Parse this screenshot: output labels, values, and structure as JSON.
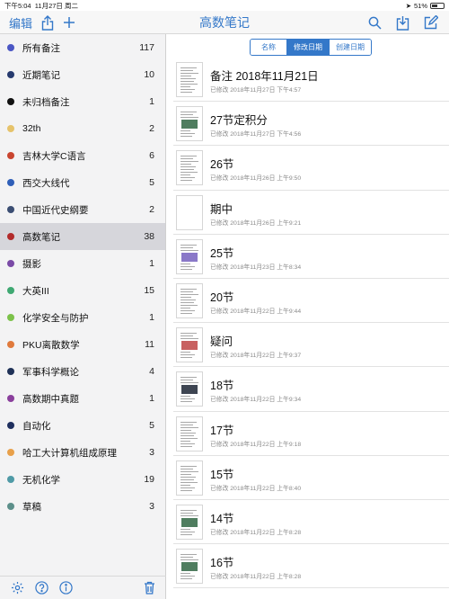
{
  "status": {
    "time": "下午5:04",
    "date": "11月27日 周二",
    "battery_text": "51%",
    "battery_level": 0.51
  },
  "nav": {
    "edit": "编辑",
    "title": "高数笔记"
  },
  "sort": {
    "name": "名称",
    "modified": "修改日期",
    "created": "创建日期",
    "active": "modified"
  },
  "folders": [
    {
      "name": "所有备注",
      "count": "117",
      "color": "#4a56c4"
    },
    {
      "name": "近期笔记",
      "count": "10",
      "color": "#263a6e"
    },
    {
      "name": "未归档备注",
      "count": "1",
      "color": "#111111"
    },
    {
      "name": "32th",
      "count": "2",
      "color": "#e6c36b"
    },
    {
      "name": "吉林大学C语言",
      "count": "6",
      "color": "#c9452f"
    },
    {
      "name": "西交大线代",
      "count": "5",
      "color": "#2f5fb8"
    },
    {
      "name": "中国近代史纲要",
      "count": "2",
      "color": "#3b4e73"
    },
    {
      "name": "高数笔记",
      "count": "38",
      "color": "#b22b2b"
    },
    {
      "name": "摄影",
      "count": "1",
      "color": "#7a4aa6"
    },
    {
      "name": "大英III",
      "count": "15",
      "color": "#3fa872"
    },
    {
      "name": "化学安全与防护",
      "count": "1",
      "color": "#7cc24a"
    },
    {
      "name": "PKU离散数学",
      "count": "11",
      "color": "#e07a3c"
    },
    {
      "name": "军事科学概论",
      "count": "4",
      "color": "#1f3157"
    },
    {
      "name": "高数期中真题",
      "count": "1",
      "color": "#8a3f9c"
    },
    {
      "name": "自动化",
      "count": "5",
      "color": "#1f2f5e"
    },
    {
      "name": "哈工大计算机组成原理",
      "count": "3",
      "color": "#e8a04a"
    },
    {
      "name": "无机化学",
      "count": "19",
      "color": "#4f9aa6"
    },
    {
      "name": "草稿",
      "count": "3",
      "color": "#5c8f8a"
    }
  ],
  "notes": [
    {
      "title": "备注 2018年11月21日",
      "meta": "已修改 2018年11月27日 下午4:57",
      "thumb": "text"
    },
    {
      "title": "27节定积分",
      "meta": "已修改 2018年11月27日 下午4:56",
      "thumb": "green"
    },
    {
      "title": "26节",
      "meta": "已修改 2018年11月26日 上午9:50",
      "thumb": "text"
    },
    {
      "title": "期中",
      "meta": "已修改 2018年11月26日 上午9:21",
      "thumb": "blank"
    },
    {
      "title": "25节",
      "meta": "已修改 2018年11月23日 上午8:34",
      "thumb": "purple"
    },
    {
      "title": "20节",
      "meta": "已修改 2018年11月22日 上午9:44",
      "thumb": "text"
    },
    {
      "title": "疑问",
      "meta": "已修改 2018年11月22日 上午9:37",
      "thumb": "red"
    },
    {
      "title": "18节",
      "meta": "已修改 2018年11月22日 上午9:34",
      "thumb": "dark"
    },
    {
      "title": "17节",
      "meta": "已修改 2018年11月22日 上午9:18",
      "thumb": "text"
    },
    {
      "title": "15节",
      "meta": "已修改 2018年11月22日 上午8:40",
      "thumb": "text"
    },
    {
      "title": "14节",
      "meta": "已修改 2018年11月22日 上午8:28",
      "thumb": "green"
    },
    {
      "title": "16节",
      "meta": "已修改 2018年11月22日 上午8:28",
      "thumb": "green"
    }
  ]
}
